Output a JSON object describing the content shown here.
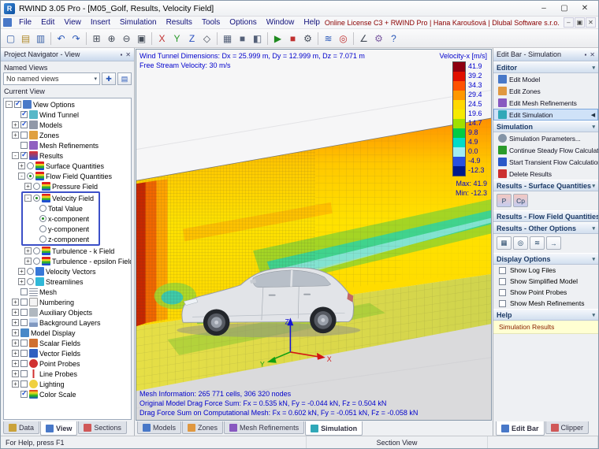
{
  "window": {
    "title": "RWIND 3.05 Pro - [M05_Golf, Results, Velocity Field]",
    "license": "Online License C3 + RWIND Pro | Hana Karoušová | Dlubal Software s.r.o."
  },
  "icons": {
    "app_letter": "R",
    "minimize": "–",
    "maximize": "▢",
    "close": "✕",
    "restore": "▣",
    "pin": "▪",
    "dropdown": "▾",
    "active_marker": "◀"
  },
  "menu": {
    "items": [
      "File",
      "Edit",
      "View",
      "Insert",
      "Simulation",
      "Results",
      "Tools",
      "Options",
      "Window",
      "Help"
    ]
  },
  "toolbar": {
    "groups": [
      [
        {
          "name": "new-file",
          "glyph": "▢",
          "color": "#3a62a8"
        },
        {
          "name": "open-file",
          "glyph": "▤",
          "color": "#b08a2a"
        },
        {
          "name": "save-file",
          "glyph": "▥",
          "color": "#3a62a8"
        }
      ],
      [
        {
          "name": "undo",
          "glyph": "↶",
          "color": "#2a58b8"
        },
        {
          "name": "redo",
          "glyph": "↷",
          "color": "#2a58b8"
        }
      ],
      [
        {
          "name": "zoom-window",
          "glyph": "⊞",
          "color": "#444c58"
        },
        {
          "name": "zoom-in",
          "glyph": "⊕",
          "color": "#444c58"
        },
        {
          "name": "zoom-out",
          "glyph": "⊖",
          "color": "#444c58"
        },
        {
          "name": "zoom-fit",
          "glyph": "▣",
          "color": "#444c58"
        }
      ],
      [
        {
          "name": "view-x",
          "glyph": "X",
          "color": "#c03030"
        },
        {
          "name": "view-y",
          "glyph": "Y",
          "color": "#2a9a2a"
        },
        {
          "name": "view-z",
          "glyph": "Z",
          "color": "#2a50c0"
        },
        {
          "name": "view-isometric",
          "glyph": "◇",
          "color": "#444c58"
        }
      ],
      [
        {
          "name": "display-wireframe",
          "glyph": "▦",
          "color": "#546078"
        },
        {
          "name": "display-solid",
          "glyph": "■",
          "color": "#546078"
        },
        {
          "name": "section-plane",
          "glyph": "◧",
          "color": "#546078"
        }
      ],
      [
        {
          "name": "run-simulation",
          "glyph": "▶",
          "color": "#1f8a1f"
        },
        {
          "name": "stop-simulation",
          "glyph": "■",
          "color": "#c03030"
        },
        {
          "name": "simulation-settings",
          "glyph": "⚙",
          "color": "#444c58"
        }
      ],
      [
        {
          "name": "show-results",
          "glyph": "≋",
          "color": "#2a58b8"
        },
        {
          "name": "point-probe",
          "glyph": "◎",
          "color": "#c03030"
        }
      ],
      [
        {
          "name": "measure",
          "glyph": "∠",
          "color": "#444c58"
        },
        {
          "name": "options",
          "glyph": "⚙",
          "color": "#7a5aa0"
        },
        {
          "name": "help",
          "glyph": "?",
          "color": "#2a58b8"
        }
      ]
    ]
  },
  "navigator": {
    "title": "Project Navigator - View",
    "named_views_label": "Named Views",
    "named_views_value": "No named views",
    "named_views_buttons": [
      {
        "name": "save-named-view",
        "glyph": "✚"
      },
      {
        "name": "manage-named-views",
        "glyph": "▤"
      }
    ],
    "current_view_label": "Current View",
    "tree": [
      {
        "l": "View Options",
        "d": 0,
        "e": "-",
        "c": "cb",
        "on": true,
        "i": "eye"
      },
      {
        "l": "Wind Tunnel",
        "d": 1,
        "e": "",
        "c": "cb",
        "on": true,
        "i": "tunnel"
      },
      {
        "l": "Models",
        "d": 1,
        "e": "+",
        "c": "cb",
        "on": true,
        "i": "model"
      },
      {
        "l": "Zones",
        "d": 1,
        "e": "+",
        "c": "cb",
        "on": false,
        "i": "zone"
      },
      {
        "l": "Mesh Refinements",
        "d": 1,
        "e": "",
        "c": "cb",
        "on": false,
        "i": "meshref"
      },
      {
        "l": "Results",
        "d": 1,
        "e": "-",
        "c": "cb",
        "on": true,
        "i": "results"
      },
      {
        "l": "Surface Quantities",
        "d": 2,
        "e": "+",
        "c": "rb",
        "on": false,
        "i": "field"
      },
      {
        "l": "Flow Field Quantities",
        "d": 2,
        "e": "-",
        "c": "rb",
        "on": true,
        "i": "field"
      },
      {
        "l": "Pressure Field",
        "d": 3,
        "e": "+",
        "c": "rb",
        "on": false,
        "i": "field"
      },
      {
        "l": "Velocity Field",
        "d": 3,
        "e": "-",
        "c": "rb",
        "on": true,
        "i": "field",
        "box": true
      },
      {
        "l": "Total Value",
        "d": 4,
        "e": "",
        "c": "rb",
        "on": false,
        "box": true
      },
      {
        "l": "x-component",
        "d": 4,
        "e": "",
        "c": "rb",
        "on": true,
        "box": true
      },
      {
        "l": "y-component",
        "d": 4,
        "e": "",
        "c": "rb",
        "on": false,
        "box": true
      },
      {
        "l": "z-component",
        "d": 4,
        "e": "",
        "c": "rb",
        "on": false,
        "box": true
      },
      {
        "l": "Turbulence - k Field",
        "d": 3,
        "e": "+",
        "c": "rb",
        "on": false,
        "i": "field"
      },
      {
        "l": "Turbulence - epsilon Field",
        "d": 3,
        "e": "+",
        "c": "rb",
        "on": false,
        "i": "field"
      },
      {
        "l": "Velocity Vectors",
        "d": 2,
        "e": "+",
        "c": "rb",
        "on": false,
        "i": "vectors"
      },
      {
        "l": "Streamlines",
        "d": 2,
        "e": "+",
        "c": "rb",
        "on": false,
        "i": "stream"
      },
      {
        "l": "Mesh",
        "d": 1,
        "e": "",
        "c": "cb",
        "on": false,
        "i": "mesh"
      },
      {
        "l": "Numbering",
        "d": 1,
        "e": "+",
        "c": "cb",
        "on": false,
        "i": "number"
      },
      {
        "l": "Auxiliary Objects",
        "d": 1,
        "e": "+",
        "c": "cb",
        "on": false,
        "i": "aux"
      },
      {
        "l": "Background Layers",
        "d": 1,
        "e": "+",
        "c": "cb",
        "on": false,
        "i": "layers"
      },
      {
        "l": "Model Display",
        "d": 1,
        "e": "+",
        "c": "",
        "on": false,
        "i": "display"
      },
      {
        "l": "Scalar Fields",
        "d": 1,
        "e": "+",
        "c": "cb",
        "on": false,
        "i": "scalar"
      },
      {
        "l": "Vector Fields",
        "d": 1,
        "e": "+",
        "c": "cb",
        "on": false,
        "i": "vector2"
      },
      {
        "l": "Point Probes",
        "d": 1,
        "e": "+",
        "c": "cb",
        "on": false,
        "i": "probe"
      },
      {
        "l": "Line Probes",
        "d": 1,
        "e": "+",
        "c": "cb",
        "on": false,
        "i": "lineprobe"
      },
      {
        "l": "Lighting",
        "d": 1,
        "e": "+",
        "c": "cb",
        "on": false,
        "i": "light"
      },
      {
        "l": "Color Scale",
        "d": 1,
        "e": "",
        "c": "cb",
        "on": true,
        "i": "colorscale"
      }
    ],
    "tabs": [
      {
        "label": "Data"
      },
      {
        "label": "View",
        "active": true
      },
      {
        "label": "Sections"
      }
    ]
  },
  "viewport": {
    "dimensions_text": "Wind Tunnel Dimensions: Dx = 25.999 m, Dy = 12.999 m, Dz = 7.071 m",
    "free_stream_text": "Free Stream Velocity: 30 m/s",
    "mesh_info_text": "Mesh Information: 265 771 cells, 306 320 nodes",
    "drag_model_text": "Original Model Drag Force Sum: Fx = 0.535 kN, Fy = -0.044 kN, Fz = 0.504 kN",
    "drag_mesh_text": "Drag Force Sum on Computational Mesh: Fx = 0.602 kN, Fy = -0.051 kN, Fz = -0.058 kN",
    "legend": {
      "title": "Velocity-x [m/s]",
      "values": [
        "41.9",
        "39.2",
        "34.3",
        "29.4",
        "24.5",
        "19.6",
        "14.7",
        "9.8",
        "4.9",
        "0.0",
        "-4.9",
        "-12.3"
      ],
      "colors": [
        "#8f0010",
        "#e01000",
        "#ff5200",
        "#ff9800",
        "#ffd800",
        "#f6ea00",
        "#a0e000",
        "#00cc44",
        "#00dcc8",
        "#a0ecf2",
        "#2850e0",
        "#001a8c"
      ],
      "max_label": "Max: 41.9",
      "min_label": "Min: -12.3"
    },
    "tabs": [
      {
        "label": "Models"
      },
      {
        "label": "Zones"
      },
      {
        "label": "Mesh Refinements"
      },
      {
        "label": "Simulation",
        "active": true
      }
    ]
  },
  "editbar": {
    "title": "Edit Bar - Simulation",
    "sections": [
      {
        "title": "Editor",
        "type": "links",
        "items": [
          {
            "label": "Edit Model",
            "icon": "em"
          },
          {
            "label": "Edit Zones",
            "icon": "ez"
          },
          {
            "label": "Edit Mesh Refinements",
            "icon": "emr"
          },
          {
            "label": "Edit Simulation",
            "icon": "es",
            "active": true
          }
        ]
      },
      {
        "title": "Simulation",
        "type": "links",
        "items": [
          {
            "label": "Simulation Parameters...",
            "icon": "sp"
          },
          {
            "label": "Continue Steady Flow Calculation",
            "icon": "cs"
          },
          {
            "label": "Start Transient Flow Calculation",
            "icon": "st"
          },
          {
            "label": "Delete Results",
            "icon": "dr"
          }
        ]
      },
      {
        "title": "Results - Surface Quantities",
        "type": "icons",
        "icons": [
          {
            "name": "pressure-result",
            "glyph": "P",
            "cls": "grad"
          },
          {
            "name": "cp-result",
            "glyph": "Cp",
            "cls": "grad"
          }
        ]
      },
      {
        "title": "Results - Flow Field Quantities",
        "type": "none"
      },
      {
        "title": "Results - Other Options",
        "type": "icons",
        "icons": [
          {
            "name": "clipper-planes",
            "glyph": "▦"
          },
          {
            "name": "point-probes",
            "glyph": "◎"
          },
          {
            "name": "streamlines",
            "glyph": "≋"
          },
          {
            "name": "velocity-vectors",
            "glyph": "→"
          }
        ]
      },
      {
        "title": "Display Options",
        "type": "checks",
        "items": [
          {
            "label": "Show Log Files",
            "checked": false
          },
          {
            "label": "Show Simplified Model",
            "checked": false
          },
          {
            "label": "Show Point Probes",
            "checked": false
          },
          {
            "label": "Show Mesh Refinements",
            "checked": false
          }
        ]
      },
      {
        "title": "Help",
        "type": "help",
        "items": [
          {
            "label": "Simulation Results"
          }
        ]
      }
    ],
    "tabs": [
      {
        "label": "Edit Bar",
        "active": true
      },
      {
        "label": "Clipper"
      }
    ]
  },
  "statusbar": {
    "help_text": "For Help, press F1",
    "view_mode": "Section View"
  }
}
